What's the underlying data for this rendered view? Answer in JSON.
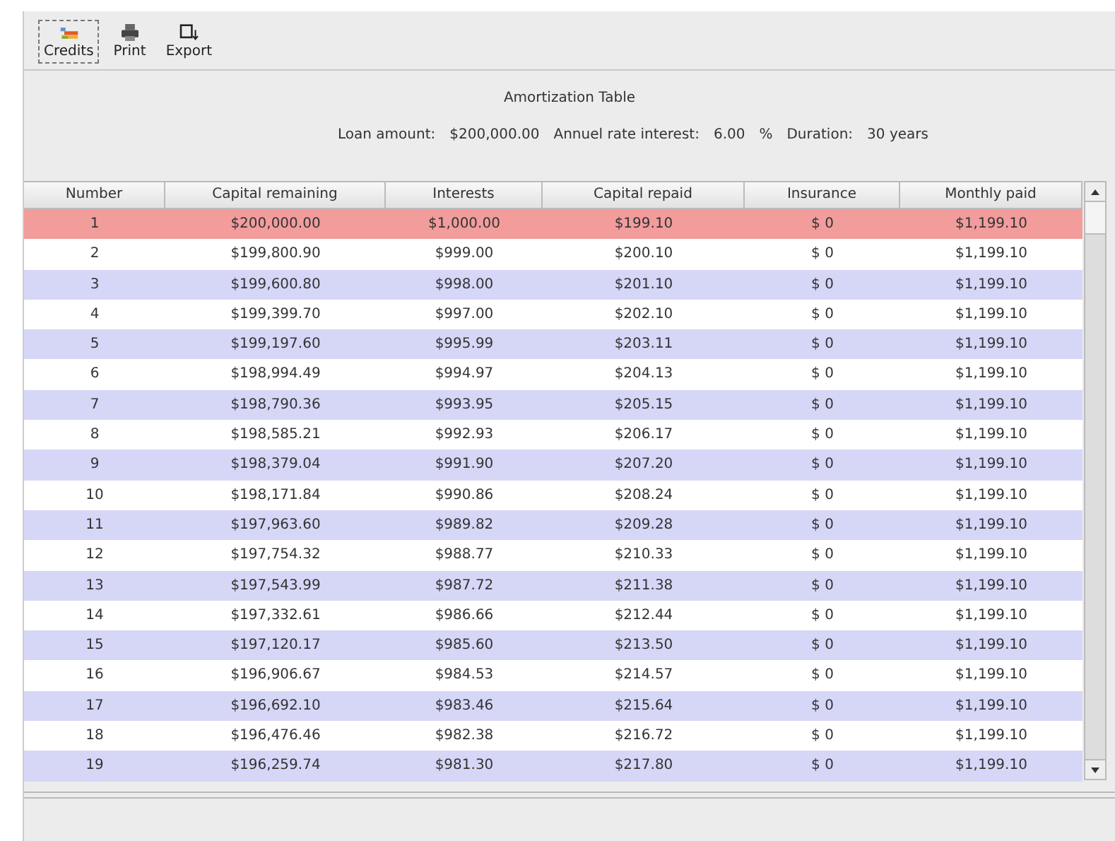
{
  "toolbar": [
    {
      "kind": "credits",
      "label": "Credits",
      "focused": true
    },
    {
      "kind": "print",
      "label": "Print",
      "focused": false
    },
    {
      "kind": "export",
      "label": "Export",
      "focused": false
    }
  ],
  "title": "Amortization Table",
  "summary": {
    "loan_label": "Loan amount:",
    "loan_value": "$200,000.00",
    "rate_label": "Annuel rate interest:",
    "rate_value": "6.00",
    "rate_unit": "%",
    "duration_label": "Duration:",
    "duration_value": "30 years"
  },
  "table": {
    "columns": [
      "Number",
      "Capital remaining",
      "Interests",
      "Capital repaid",
      "Insurance",
      "Monthly paid"
    ],
    "rows": [
      {
        "selected": true,
        "cells": [
          "1",
          "$200,000.00",
          "$1,000.00",
          "$199.10",
          "$ 0",
          "$1,199.10"
        ]
      },
      {
        "selected": false,
        "cells": [
          "2",
          "$199,800.90",
          "$999.00",
          "$200.10",
          "$ 0",
          "$1,199.10"
        ]
      },
      {
        "selected": false,
        "cells": [
          "3",
          "$199,600.80",
          "$998.00",
          "$201.10",
          "$ 0",
          "$1,199.10"
        ]
      },
      {
        "selected": false,
        "cells": [
          "4",
          "$199,399.70",
          "$997.00",
          "$202.10",
          "$ 0",
          "$1,199.10"
        ]
      },
      {
        "selected": false,
        "cells": [
          "5",
          "$199,197.60",
          "$995.99",
          "$203.11",
          "$ 0",
          "$1,199.10"
        ]
      },
      {
        "selected": false,
        "cells": [
          "6",
          "$198,994.49",
          "$994.97",
          "$204.13",
          "$ 0",
          "$1,199.10"
        ]
      },
      {
        "selected": false,
        "cells": [
          "7",
          "$198,790.36",
          "$993.95",
          "$205.15",
          "$ 0",
          "$1,199.10"
        ]
      },
      {
        "selected": false,
        "cells": [
          "8",
          "$198,585.21",
          "$992.93",
          "$206.17",
          "$ 0",
          "$1,199.10"
        ]
      },
      {
        "selected": false,
        "cells": [
          "9",
          "$198,379.04",
          "$991.90",
          "$207.20",
          "$ 0",
          "$1,199.10"
        ]
      },
      {
        "selected": false,
        "cells": [
          "10",
          "$198,171.84",
          "$990.86",
          "$208.24",
          "$ 0",
          "$1,199.10"
        ]
      },
      {
        "selected": false,
        "cells": [
          "11",
          "$197,963.60",
          "$989.82",
          "$209.28",
          "$ 0",
          "$1,199.10"
        ]
      },
      {
        "selected": false,
        "cells": [
          "12",
          "$197,754.32",
          "$988.77",
          "$210.33",
          "$ 0",
          "$1,199.10"
        ]
      },
      {
        "selected": false,
        "cells": [
          "13",
          "$197,543.99",
          "$987.72",
          "$211.38",
          "$ 0",
          "$1,199.10"
        ]
      },
      {
        "selected": false,
        "cells": [
          "14",
          "$197,332.61",
          "$986.66",
          "$212.44",
          "$ 0",
          "$1,199.10"
        ]
      },
      {
        "selected": false,
        "cells": [
          "15",
          "$197,120.17",
          "$985.60",
          "$213.50",
          "$ 0",
          "$1,199.10"
        ]
      },
      {
        "selected": false,
        "cells": [
          "16",
          "$196,906.67",
          "$984.53",
          "$214.57",
          "$ 0",
          "$1,199.10"
        ]
      },
      {
        "selected": false,
        "cells": [
          "17",
          "$196,692.10",
          "$983.46",
          "$215.64",
          "$ 0",
          "$1,199.10"
        ]
      },
      {
        "selected": false,
        "cells": [
          "18",
          "$196,476.46",
          "$982.38",
          "$216.72",
          "$ 0",
          "$1,199.10"
        ]
      },
      {
        "selected": false,
        "cells": [
          "19",
          "$196,259.74",
          "$981.30",
          "$217.80",
          "$ 0",
          "$1,199.10"
        ]
      }
    ]
  }
}
